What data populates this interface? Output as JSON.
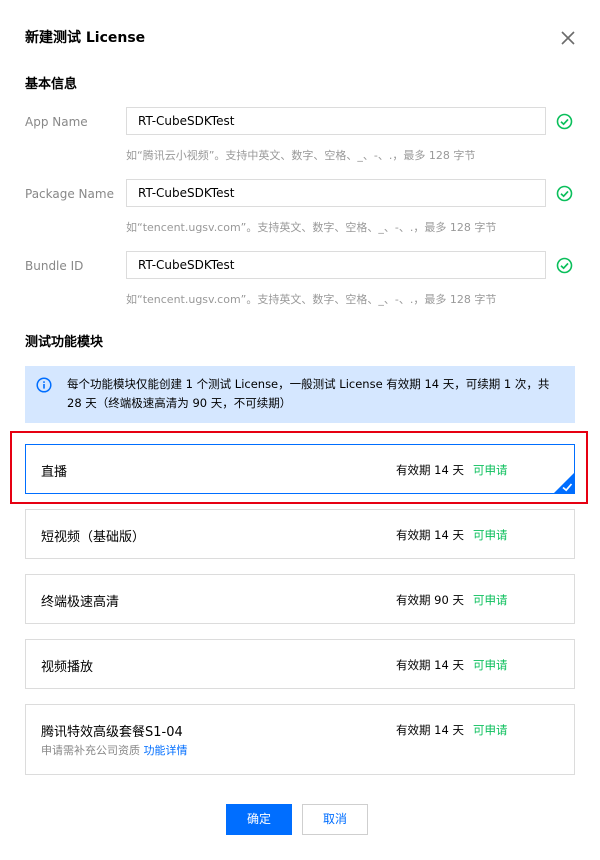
{
  "dialog": {
    "title": "新建测试 License",
    "close_icon": "close-icon"
  },
  "basic_info": {
    "heading": "基本信息",
    "fields": [
      {
        "label": "App Name",
        "value": "RT-CubeSDKTest",
        "hint": "如“腾讯云小视频”。支持中英文、数字、空格、_、-、.，最多 128 字节",
        "valid": true
      },
      {
        "label": "Package Name",
        "value": "RT-CubeSDKTest",
        "hint": "如“tencent.ugsv.com”。支持英文、数字、空格、_、-、.，最多 128 字节",
        "valid": true
      },
      {
        "label": "Bundle ID",
        "value": "RT-CubeSDKTest",
        "hint": "如“tencent.ugsv.com”。支持英文、数字、空格、_、-、.，最多 128 字节",
        "valid": true
      }
    ]
  },
  "modules": {
    "heading": "测试功能模块",
    "info": "每个功能模块仅能创建 1 个测试 License，一般测试 License 有效期 14 天，可续期 1 次，共 28 天（终端极速高清为 90 天，不可续期）",
    "items": [
      {
        "name": "直播",
        "validity": "有效期 14 天",
        "status": "可申请",
        "selected": true
      },
      {
        "name": "短视频（基础版）",
        "validity": "有效期 14 天",
        "status": "可申请",
        "selected": false
      },
      {
        "name": "终端极速高清",
        "validity": "有效期 90 天",
        "status": "可申请",
        "selected": false
      },
      {
        "name": "视频播放",
        "validity": "有效期 14 天",
        "status": "可申请",
        "selected": false
      },
      {
        "name": "腾讯特效高级套餐S1-04",
        "validity": "有效期 14 天",
        "status": "可申请",
        "selected": false,
        "note": "申请需补充公司资质",
        "link": "功能详情"
      }
    ]
  },
  "footer": {
    "confirm_label": "确定",
    "cancel_label": "取消"
  },
  "colors": {
    "accent": "#006eff",
    "success": "#0abf5b",
    "info_bg": "#d5e7ff",
    "highlight": "#e60012"
  }
}
